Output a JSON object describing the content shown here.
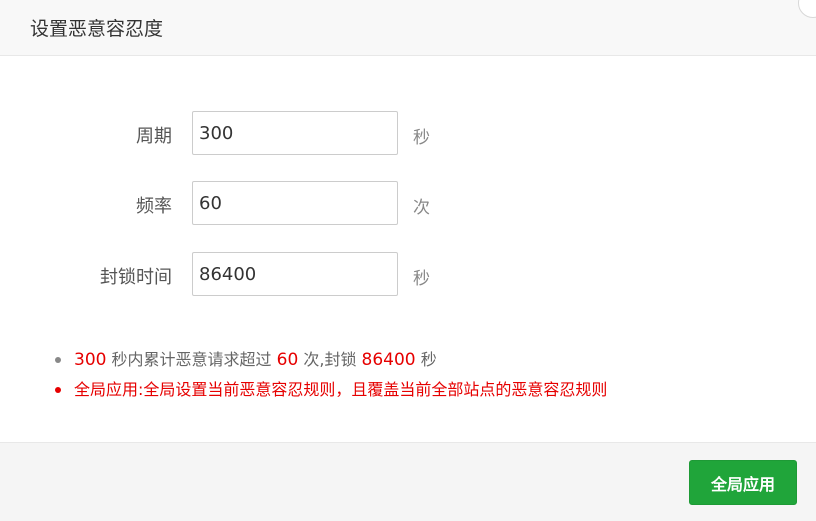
{
  "dialog": {
    "title": "设置恶意容忍度"
  },
  "form": {
    "period": {
      "label": "周期",
      "value": "300",
      "unit": "秒"
    },
    "frequency": {
      "label": "频率",
      "value": "60",
      "unit": "次"
    },
    "ban_time": {
      "label": "封锁时间",
      "value": "86400",
      "unit": "秒"
    }
  },
  "tips": {
    "summary": {
      "period": "300",
      "text_1": " 秒内累计恶意请求超过 ",
      "frequency": "60",
      "text_2": " 次,封锁 ",
      "ban_time": "86400",
      "text_3": " 秒"
    },
    "global_note": "全局应用:全局设置当前恶意容忍规则，且覆盖当前全部站点的恶意容忍规则"
  },
  "footer": {
    "apply_label": "全局应用"
  },
  "colors": {
    "accent_green": "#20a53a",
    "warning_red": "#e60000"
  }
}
